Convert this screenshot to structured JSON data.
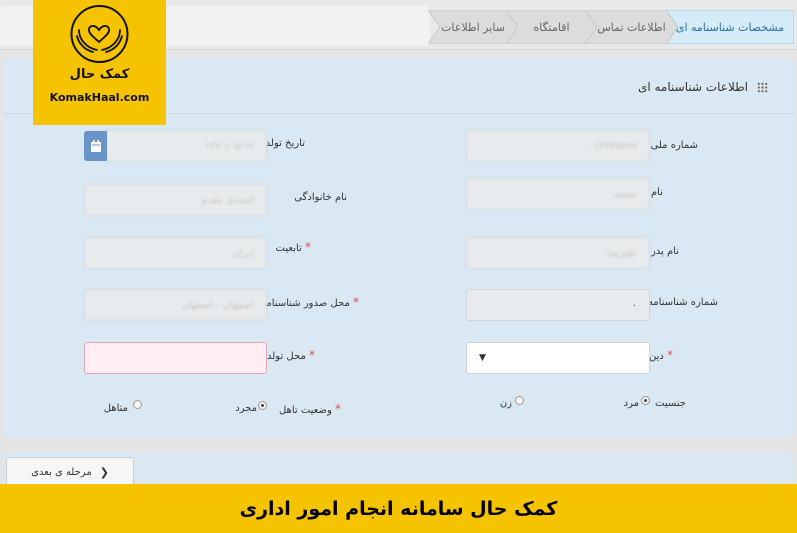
{
  "logo": {
    "name": "کمک حال",
    "site": "KomakHaal.com"
  },
  "steps": [
    {
      "label": "مشخصات شناسنامه ای",
      "active": true
    },
    {
      "label": "اطلاعات تماس",
      "active": false
    },
    {
      "label": "اقامتگاه",
      "active": false
    },
    {
      "label": "سایر اطلاعات",
      "active": false
    }
  ],
  "panel": {
    "title": "اطلاعات شناسنامه ای",
    "required_marker": "*",
    "fields": {
      "national_id": {
        "label": "شماره ملی",
        "value": "۰۰۱۲۳۴۵۶۷۸"
      },
      "birth_date": {
        "label": "تاریخ تولد",
        "value": "۱۳۷۰/۰۵/۱۲"
      },
      "first_name": {
        "label": "نام",
        "value": "محمد"
      },
      "last_name": {
        "label": "نام خانوادگی",
        "value": "احمدی مقدم"
      },
      "father_name": {
        "label": "نام پدر",
        "value": "علیرضا"
      },
      "nationality": {
        "label": "تابعیت",
        "value": "ایران"
      },
      "id_number": {
        "label": "شماره شناسنامه",
        "value": "۰"
      },
      "issue_place": {
        "label": "محل صدور شناسنامه",
        "value": "اصفهان - اصفهان"
      },
      "religion": {
        "label": "دین",
        "value": ""
      },
      "birth_place": {
        "label": "محل تولد",
        "value": ""
      },
      "gender": {
        "label": "جنسیت",
        "options": [
          "مرد",
          "زن"
        ],
        "selected": "مرد"
      },
      "marital": {
        "label": "وضعیت تاهل",
        "options": [
          "مجرد",
          "متاهل"
        ],
        "selected": "مجرد"
      }
    }
  },
  "footer": {
    "next_label": "مرحله ی بعدی",
    "next_icon": "chevron-left-icon"
  },
  "banner": {
    "text": "کمک حال سامانه انجام امور اداری"
  },
  "colors": {
    "panel": "#d9e8f2",
    "banner": "#f6c300",
    "accent": "#6a93c8",
    "error_bg": "#ffeef2"
  }
}
